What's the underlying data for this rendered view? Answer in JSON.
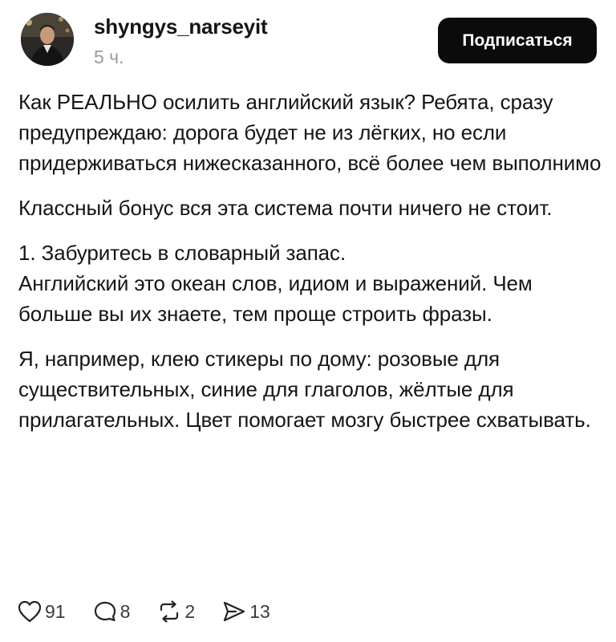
{
  "post": {
    "author": {
      "username": "shyngys_narseyit",
      "timestamp": "5 ч.",
      "avatar_icon": "avatar-photo"
    },
    "subscribe_label": "Подписаться",
    "paragraphs": [
      "Как РЕАЛЬНО осилить английский язык? Ребята, сразу предупреждаю: дорога будет не из лёгких, но если придерживаться нижесказанного, всё более чем выполнимо",
      "Классный бонус вся эта система почти ничего не стоит.",
      "1. Забуритесь в словарный запас.",
      "Английский это океан слов, идиом и выражений. Чем больше вы их знаете, тем проще строить фразы.",
      "Я, например, клею стикеры по дому: розовые для существительных, синие для глаголов, жёлтые для прилагательных. Цвет помогает мозгу быстрее схватывать."
    ],
    "actions": {
      "likes": {
        "icon": "heart-icon",
        "count": "91"
      },
      "comments": {
        "icon": "comment-icon",
        "count": "8"
      },
      "reposts": {
        "icon": "repost-icon",
        "count": "2"
      },
      "shares": {
        "icon": "share-icon",
        "count": "13"
      }
    }
  },
  "colors": {
    "text": "#151515",
    "muted": "#9a9a9a",
    "button_bg": "#0b0b0b",
    "button_text": "#ffffff",
    "background": "#ffffff"
  }
}
